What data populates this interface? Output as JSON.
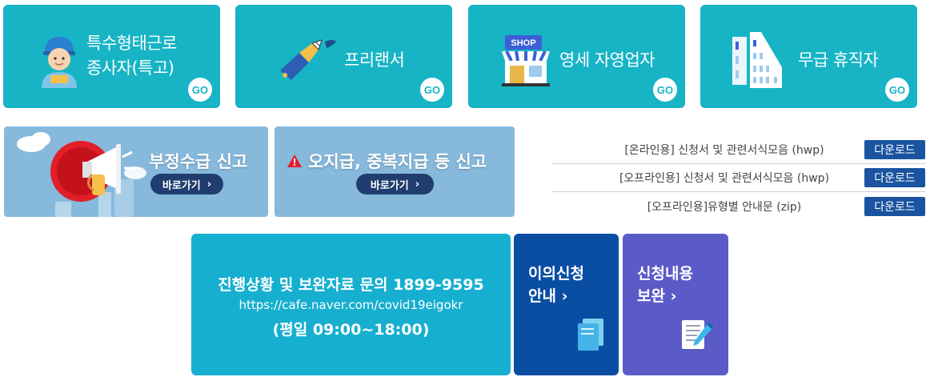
{
  "tiles": [
    {
      "line1": "특수형태근로",
      "line2": "종사자(특고)",
      "go": "GO",
      "icon": "worker-icon"
    },
    {
      "line1": "프리랜서",
      "go": "GO",
      "icon": "pen-icon"
    },
    {
      "line1": "영세 자영업자",
      "go": "GO",
      "icon": "shop-icon",
      "shop_sign": "SHOP"
    },
    {
      "line1": "무급 휴직자",
      "go": "GO",
      "icon": "building-icon"
    }
  ],
  "banners": [
    {
      "title": "부정수급 신고",
      "button": "바로가기",
      "chevron": "›",
      "icon": "megaphone-icon"
    },
    {
      "title": "오지급, 중복지급 등 신고",
      "button": "바로가기",
      "chevron": "›",
      "icon": "warning-icon"
    }
  ],
  "downloads": [
    {
      "label": "[온라인용] 신청서 및 관련서식모음 (hwp)",
      "button": "다운로드"
    },
    {
      "label": "[오프라인용] 신청서 및 관련서식모음 (hwp)",
      "button": "다운로드"
    },
    {
      "label": "[오프라인용]유형별 안내문 (zip)",
      "button": "다운로드"
    }
  ],
  "contact": {
    "line1": "진행상황 및 보완자료 문의 1899-9595",
    "line2": "https://cafe.naver.com/covid19eigokr",
    "line3": "(평일 09:00~18:00)"
  },
  "cards": [
    {
      "line1": "이의신청",
      "line2": "안내 ›",
      "icon": "documents-icon"
    },
    {
      "line1": "신청내용",
      "line2": "보완 ›",
      "icon": "form-edit-icon"
    }
  ],
  "colors": {
    "tile": "#17b4c6",
    "banner": "#86b9dc",
    "pill": "#1f3d6e",
    "download_button": "#1a54a0",
    "contact_box": "#16afd0",
    "appeal_card": "#0a4ea4",
    "supplement_card": "#5b5bc8"
  }
}
